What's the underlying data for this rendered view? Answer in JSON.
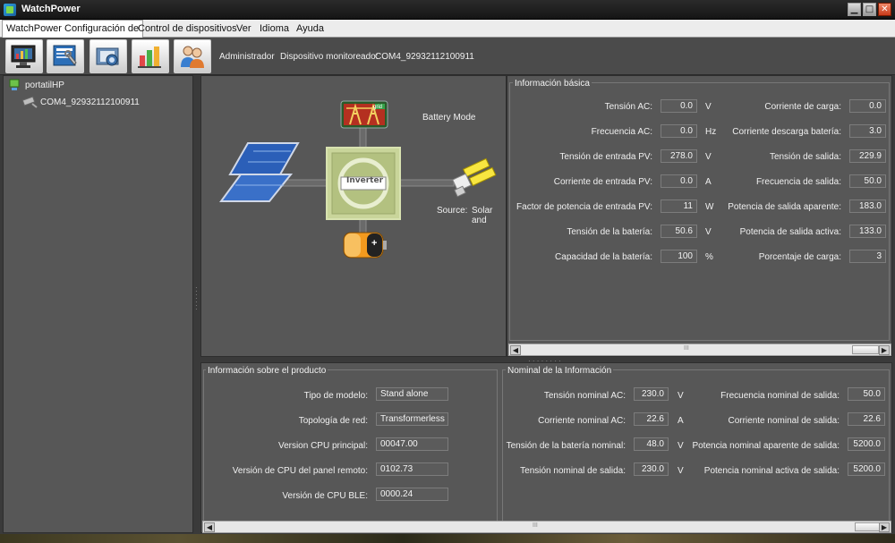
{
  "window": {
    "title": "WatchPower"
  },
  "menu": [
    "WatchPower Configuración de",
    "Control de dispositivos",
    "Ver",
    "Idioma",
    "Ayuda"
  ],
  "toolbar": {
    "buttons": [
      "monitor-icon",
      "settings-icon",
      "camera-icon",
      "data-chart-icon",
      "users-icon"
    ],
    "user": "Administrador",
    "device_label": "Dispositivo monitoreado:",
    "device_value": "COM4_92932112100911"
  },
  "tree": {
    "root": "portatilHP",
    "child": "COM4_92932112100911"
  },
  "diagram": {
    "mode": "Battery Mode",
    "inverter_label": "Inverter",
    "grid_label": "grid",
    "source_label": "Source:",
    "source_value": "Solar and",
    "battery_symbol": "+"
  },
  "basic_info": {
    "title": "Información básica",
    "left": [
      {
        "label": "Tensión AC:",
        "value": "0.0",
        "unit": "V"
      },
      {
        "label": "Frecuencia AC:",
        "value": "0.0",
        "unit": "Hz"
      },
      {
        "label": "Tensión de entrada PV:",
        "value": "278.0",
        "unit": "V"
      },
      {
        "label": "Corriente de entrada PV:",
        "value": "0.0",
        "unit": "A"
      },
      {
        "label": "Factor de potencia de entrada PV:",
        "value": "11",
        "unit": "W"
      },
      {
        "label": "Tensión de la batería:",
        "value": "50.6",
        "unit": "V"
      },
      {
        "label": "Capacidad de la batería:",
        "value": "100",
        "unit": "%"
      }
    ],
    "right": [
      {
        "label": "Corriente de carga:",
        "value": "0.0"
      },
      {
        "label": "Corriente descarga batería:",
        "value": "3.0"
      },
      {
        "label": "Tensión de salida:",
        "value": "229.9"
      },
      {
        "label": "Frecuencia de salida:",
        "value": "50.0"
      },
      {
        "label": "Potencia de salida aparente:",
        "value": "183.0"
      },
      {
        "label": "Potencia de salida activa:",
        "value": "133.0"
      },
      {
        "label": "Porcentaje de carga:",
        "value": "3"
      }
    ],
    "scroll_label": "III"
  },
  "product_info": {
    "title": "Información sobre el producto",
    "rows": [
      {
        "label": "Tipo de modelo:",
        "value": "Stand alone"
      },
      {
        "label": "Topología de red:",
        "value": "Transformerless"
      },
      {
        "label": "Version CPU principal:",
        "value": "00047.00"
      },
      {
        "label": "Versión de CPU del panel remoto:",
        "value": "0102.73"
      },
      {
        "label": "Versión de CPU BLE:",
        "value": "0000.24"
      }
    ]
  },
  "nominal_info": {
    "title": "Nominal de la Información",
    "left": [
      {
        "label": "Tensión nominal AC:",
        "value": "230.0",
        "unit": "V"
      },
      {
        "label": "Corriente nominal AC:",
        "value": "22.6",
        "unit": "A"
      },
      {
        "label": "Tensión de la batería nominal:",
        "value": "48.0",
        "unit": "V"
      },
      {
        "label": "Tensión nominal de salida:",
        "value": "230.0",
        "unit": "V"
      }
    ],
    "right": [
      {
        "label": "Frecuencia nominal de salida:",
        "value": "50.0"
      },
      {
        "label": "Corriente nominal de salida:",
        "value": "22.6"
      },
      {
        "label": "Potencia nominal aparente de salida:",
        "value": "5200.0"
      },
      {
        "label": "Potencia nominal activa de salida:",
        "value": "5200.0"
      }
    ],
    "scroll_label": "III"
  },
  "colors": {
    "background": "#575757",
    "titlebar": "#151515",
    "menubar": "#ececec",
    "battery": "#f39a1e",
    "inverter": "#c9d59a"
  }
}
